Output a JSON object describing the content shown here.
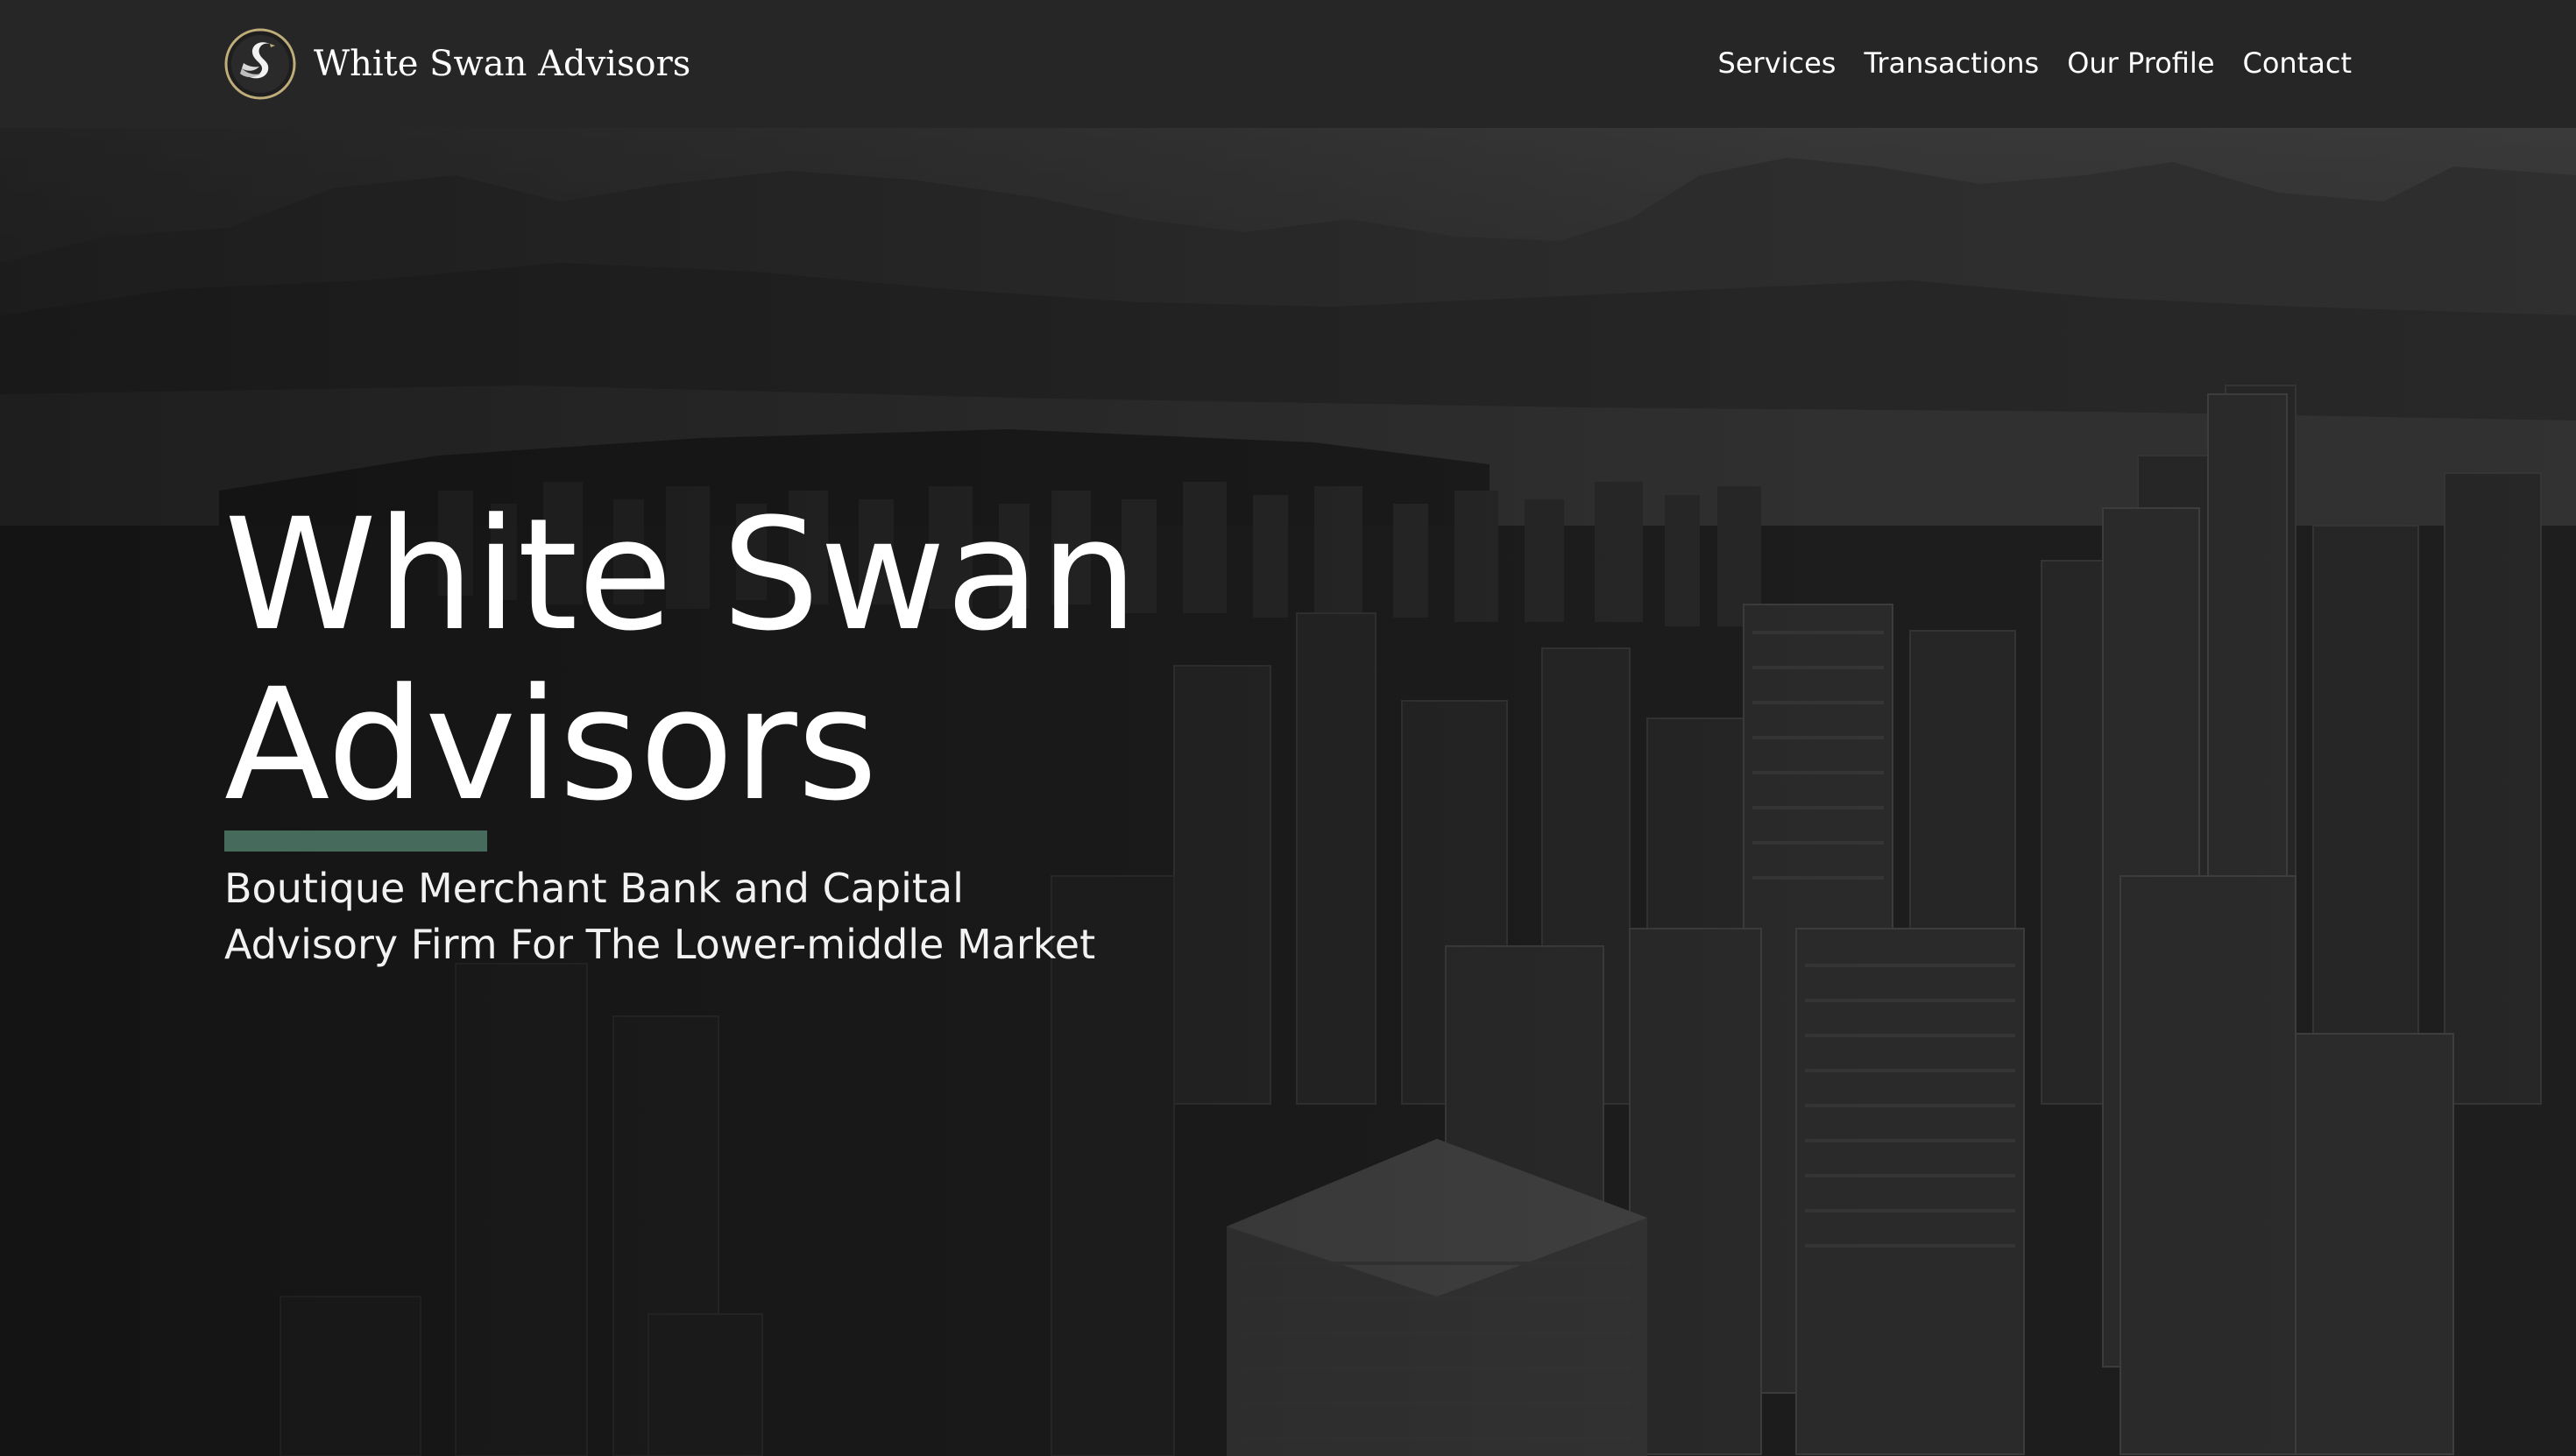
{
  "brand": {
    "name": "White Swan Advisors",
    "logo_icon": "swan-logo-icon"
  },
  "nav": {
    "items": [
      {
        "label": "Services"
      },
      {
        "label": "Transactions"
      },
      {
        "label": "Our Profile"
      },
      {
        "label": "Contact"
      }
    ]
  },
  "hero": {
    "title_line_1": "White Swan",
    "title_line_2": "Advisors",
    "subtitle_line_1": "Boutique Merchant Bank and Capital",
    "subtitle_line_2": "Advisory Firm For The Lower-middle Market",
    "background": "aerial-city-skyline-image"
  },
  "colors": {
    "navbar_bg": "#262626",
    "accent_bar": "#466a5c",
    "text": "#ffffff"
  }
}
